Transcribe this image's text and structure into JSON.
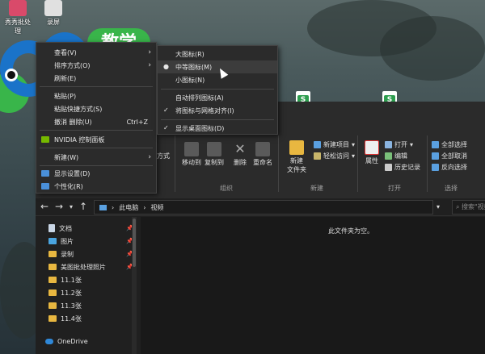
{
  "desktop": {
    "icons": [
      {
        "label": "秀秀批处\n理"
      },
      {
        "label": "录屏"
      }
    ]
  },
  "logo": {
    "text": "教学",
    "brand": "c6"
  },
  "context_menu": {
    "items": [
      {
        "label": "查看(V)",
        "arrow": "›"
      },
      {
        "label": "排序方式(O)",
        "arrow": "›"
      },
      {
        "label": "刷新(E)"
      },
      {
        "label": "粘贴(P)"
      },
      {
        "label": "粘贴快捷方式(S)"
      },
      {
        "label": "撤消 删除(U)",
        "shortcut": "Ctrl+Z"
      },
      {
        "label": "NVIDIA 控制面板"
      },
      {
        "label": "新建(W)",
        "arrow": "›"
      },
      {
        "label": "显示设置(D)"
      },
      {
        "label": "个性化(R)"
      }
    ]
  },
  "view_submenu": {
    "items": [
      {
        "label": "大图标(R)",
        "mark": ""
      },
      {
        "label": "中等图标(M)",
        "mark": "●"
      },
      {
        "label": "小图标(N)",
        "mark": ""
      },
      {
        "label": "自动排列图标(A)",
        "mark": ""
      },
      {
        "label": "将图标与网格对齐(I)",
        "mark": "✓"
      },
      {
        "label": "显示桌面图标(D)",
        "mark": "✓"
      }
    ]
  },
  "ribbon": {
    "groups": {
      "organize": "组织",
      "new": "新建",
      "open": "打开",
      "select": "选择"
    },
    "buttons": {
      "copy_path": "方式",
      "move_to": "移动到",
      "copy_to": "复制到",
      "delete": "删除",
      "rename": "重命名",
      "new_folder": "新建\n文件夹",
      "new_item": "新建项目",
      "easy_access": "轻松访问",
      "properties": "属性",
      "open": "打开",
      "edit": "编辑",
      "history": "历史记录",
      "select_all": "全部选择",
      "select_none": "全部取消",
      "invert_selection": "反向选择"
    }
  },
  "address": {
    "path": [
      "此电脑",
      "视频"
    ],
    "search_placeholder": "搜索\"视频\""
  },
  "nav_pane": {
    "items": [
      {
        "label": "文档",
        "icon": "doc",
        "pinned": true
      },
      {
        "label": "图片",
        "icon": "img",
        "pinned": true
      },
      {
        "label": "录制",
        "icon": "folder",
        "pinned": true
      },
      {
        "label": "美图批处理照片",
        "icon": "folder",
        "pinned": true
      },
      {
        "label": "11.1张",
        "icon": "folder",
        "pinned": false
      },
      {
        "label": "11.2张",
        "icon": "folder",
        "pinned": false
      },
      {
        "label": "11.3张",
        "icon": "folder",
        "pinned": false
      },
      {
        "label": "11.4张",
        "icon": "folder",
        "pinned": false
      },
      {
        "label": "OneDrive",
        "icon": "cloud",
        "pinned": false
      }
    ]
  },
  "content": {
    "empty_message": "此文件夹为空。"
  },
  "colors": {
    "accent_blue": "#1a73c9",
    "accent_green": "#39b54a",
    "folder": "#e8b740"
  }
}
